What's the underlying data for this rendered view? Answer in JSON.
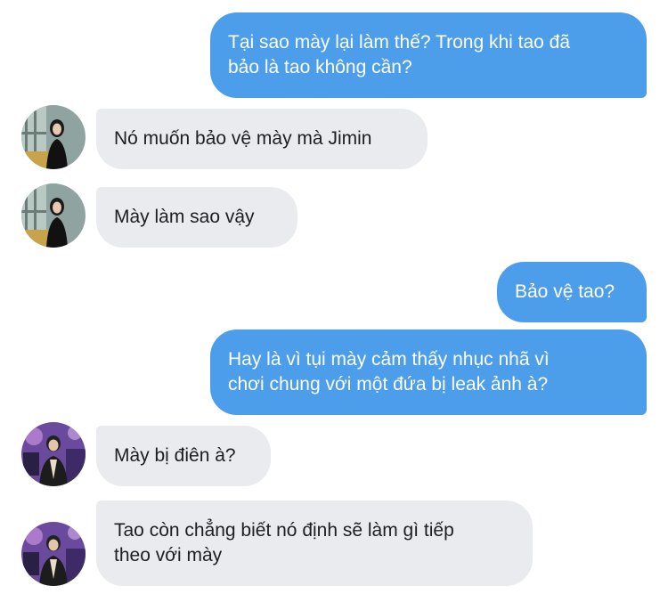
{
  "conversation": {
    "messages": [
      {
        "side": "outgoing",
        "lines": [
          "Tại sao mày lại làm thế? Trong khi tao đã",
          "bảo là tao không cần?"
        ]
      },
      {
        "side": "incoming",
        "sender": "girl",
        "lines": [
          "Nó muốn bảo vệ mày mà Jimin"
        ]
      },
      {
        "side": "incoming",
        "sender": "girl",
        "lines": [
          "Mày làm sao vậy"
        ]
      },
      {
        "side": "outgoing",
        "lines": [
          "Bảo vệ tao?"
        ]
      },
      {
        "side": "outgoing",
        "lines": [
          "Hay là vì tụi mày cảm thấy nhục nhã vì",
          "chơi chung với một đứa bị leak ảnh à?"
        ]
      },
      {
        "side": "incoming",
        "sender": "boy",
        "lines": [
          "Mày bị điên à?"
        ]
      },
      {
        "side": "incoming",
        "sender": "boy",
        "lines": [
          "Tao còn chẳng biết nó định sẽ làm gì tiếp",
          "theo với mày"
        ]
      }
    ]
  },
  "theme": {
    "outgoing_bubble": "#4c9eea",
    "incoming_bubble": "#e9ebee",
    "incoming_text": "#1c1e21",
    "outgoing_text": "#ffffff"
  },
  "avatars": {
    "girl": "profile-photo-girl-icon",
    "boy": "profile-photo-boy-icon"
  }
}
